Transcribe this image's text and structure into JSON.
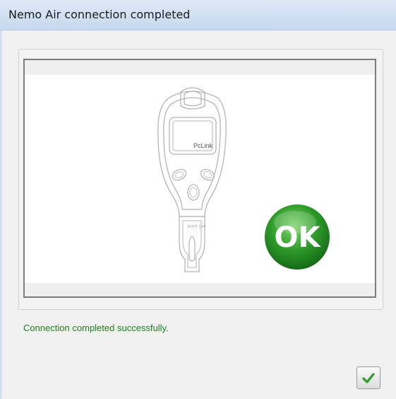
{
  "window": {
    "title": "Nemo Air connection completed"
  },
  "illustration": {
    "device_screen_text": "PcLink",
    "badge_text": "OK",
    "badge_color": "#2e9a2a"
  },
  "status": {
    "message": "Connection completed successfully.",
    "color": "#19851c"
  },
  "buttons": {
    "confirm": {
      "icon": "checkmark-icon",
      "color": "#2e9e2e"
    }
  }
}
